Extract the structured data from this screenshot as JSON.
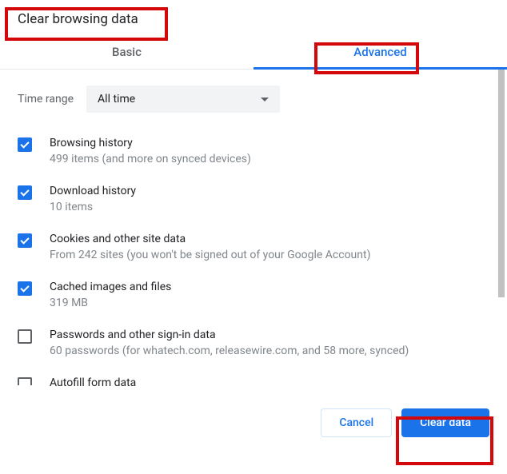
{
  "dialog": {
    "title": "Clear browsing data"
  },
  "tabs": {
    "basic": "Basic",
    "advanced": "Advanced"
  },
  "time_range": {
    "label": "Time range",
    "value": "All time"
  },
  "items": [
    {
      "title": "Browsing history",
      "sub": "499 items (and more on synced devices)",
      "checked": true
    },
    {
      "title": "Download history",
      "sub": "10 items",
      "checked": true
    },
    {
      "title": "Cookies and other site data",
      "sub": "From 242 sites (you won't be signed out of your Google Account)",
      "checked": true
    },
    {
      "title": "Cached images and files",
      "sub": "319 MB",
      "checked": true
    },
    {
      "title": "Passwords and other sign-in data",
      "sub": "60 passwords (for whatech.com, releasewire.com, and 58 more, synced)",
      "checked": false
    },
    {
      "title": "Autofill form data",
      "sub": "",
      "checked": false
    }
  ],
  "footer": {
    "cancel": "Cancel",
    "clear": "Clear data"
  }
}
